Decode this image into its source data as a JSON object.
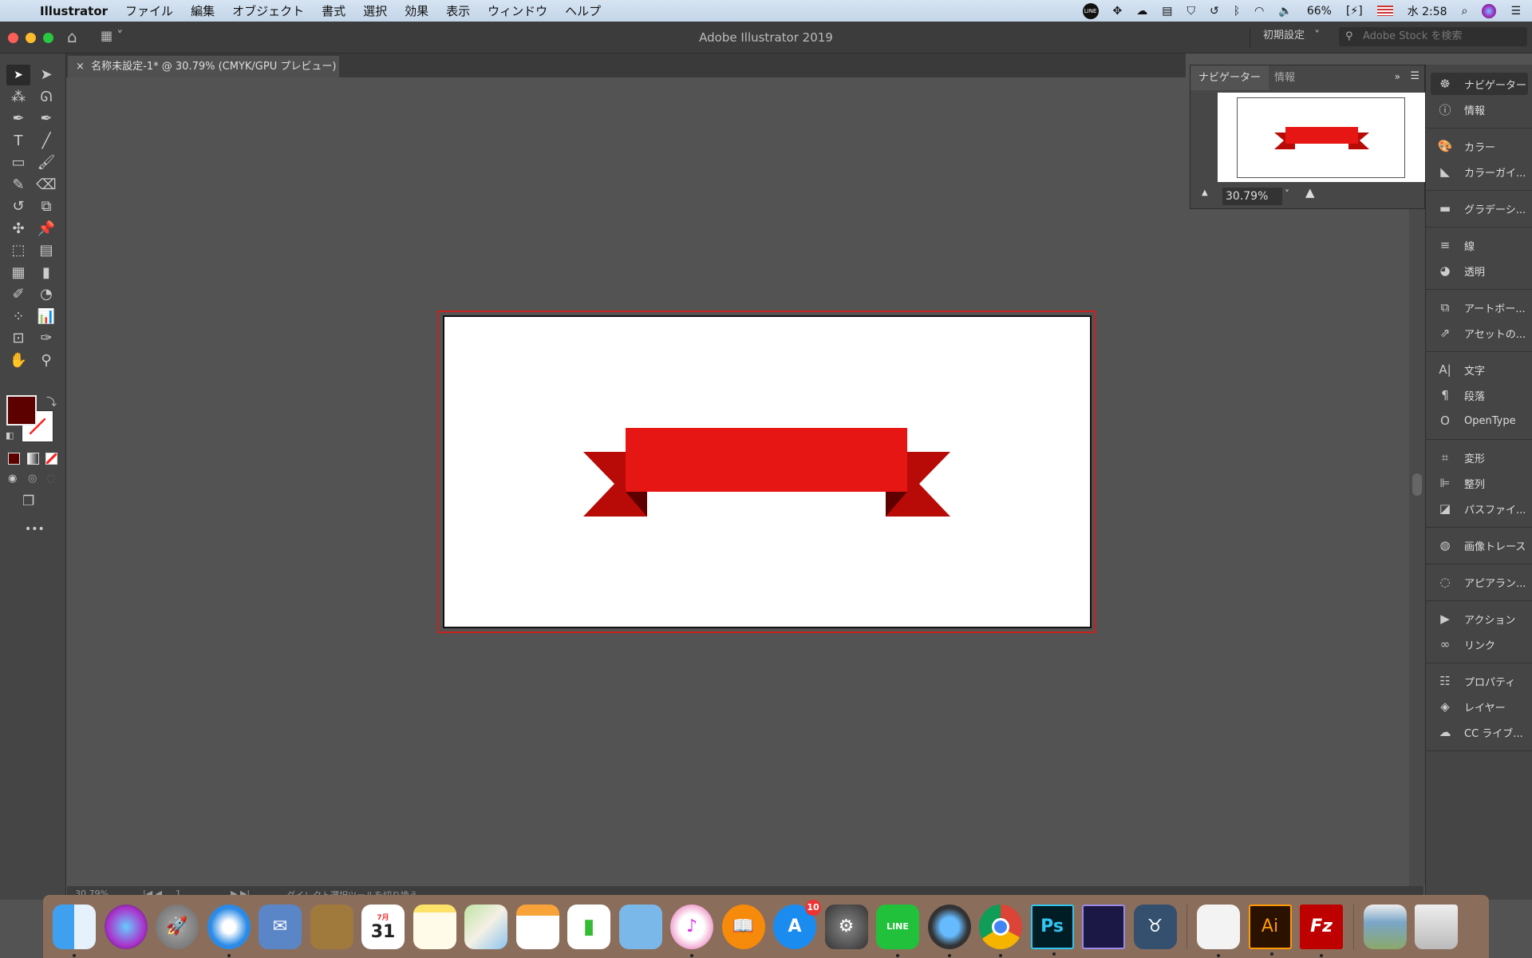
{
  "menubar": {
    "apple": "",
    "app": "Illustrator",
    "items": [
      "ファイル",
      "編集",
      "オブジェクト",
      "書式",
      "選択",
      "効果",
      "表示",
      "ウィンドウ",
      "ヘルプ"
    ],
    "status": {
      "battery": "66%",
      "clock": "水 2:58",
      "line": "LINE"
    }
  },
  "appbar": {
    "title": "Adobe Illustrator 2019",
    "workspace": "初期設定",
    "search_placeholder": "Adobe Stock を検索"
  },
  "document_tab": {
    "close": "×",
    "title": "名称未設定-1* @ 30.79% (CMYK/GPU プレビュー)"
  },
  "tools": [
    "selection",
    "direct-selection",
    "magic-wand",
    "lasso",
    "pen",
    "curvature",
    "type",
    "line-segment",
    "rectangle",
    "paintbrush",
    "shaper",
    "eraser",
    "rotate",
    "scale",
    "puppet-warp",
    "pin",
    "free-transform",
    "perspective-grid",
    "mesh",
    "gradient",
    "eyedropper",
    "blend",
    "symbol-sprayer",
    "column-graph",
    "artboard",
    "slice",
    "hand",
    "zoom"
  ],
  "colors": {
    "fill": "#5c0000",
    "ribbon_main": "#e51613",
    "ribbon_tail": "#b80a07",
    "ribbon_fold": "#5e0000",
    "artboard_outline": "#c8221f"
  },
  "navigator": {
    "tabs": [
      "ナビゲーター",
      "情報"
    ],
    "zoom": "30.79%"
  },
  "panels": [
    {
      "icon": "navigator-icon",
      "label": "ナビゲーター"
    },
    {
      "icon": "info-icon",
      "label": "情報"
    },
    {
      "icon": "color-icon",
      "label": "カラー"
    },
    {
      "icon": "color-guide-icon",
      "label": "カラーガイ..."
    },
    {
      "icon": "gradient-icon",
      "label": "グラデーシ..."
    },
    {
      "icon": "stroke-icon",
      "label": "線"
    },
    {
      "icon": "transparency-icon",
      "label": "透明"
    },
    {
      "icon": "artboards-icon",
      "label": "アートボー..."
    },
    {
      "icon": "asset-export-icon",
      "label": "アセットの..."
    },
    {
      "icon": "character-icon",
      "label": "文字"
    },
    {
      "icon": "paragraph-icon",
      "label": "段落"
    },
    {
      "icon": "opentype-icon",
      "label": "OpenType"
    },
    {
      "icon": "transform-icon",
      "label": "変形"
    },
    {
      "icon": "align-icon",
      "label": "整列"
    },
    {
      "icon": "pathfinder-icon",
      "label": "パスファイ..."
    },
    {
      "icon": "image-trace-icon",
      "label": "画像トレース"
    },
    {
      "icon": "appearance-icon",
      "label": "アピアラン..."
    },
    {
      "icon": "actions-icon",
      "label": "アクション"
    },
    {
      "icon": "links-icon",
      "label": "リンク"
    },
    {
      "icon": "properties-icon",
      "label": "プロパティ"
    },
    {
      "icon": "layers-icon",
      "label": "レイヤー"
    },
    {
      "icon": "cc-libraries-icon",
      "label": "CC ライブ..."
    }
  ],
  "statusbar": {
    "zoom": "30.79%",
    "artboard": "1",
    "hint": "ダイレクト選択ツールを切り換え"
  },
  "dock": {
    "calendar_month": "7月",
    "calendar_day": "31",
    "appstore_badge": "10",
    "line": "LINE",
    "ps": "Ps",
    "ai": "Ai",
    "filezilla": "Fz"
  }
}
